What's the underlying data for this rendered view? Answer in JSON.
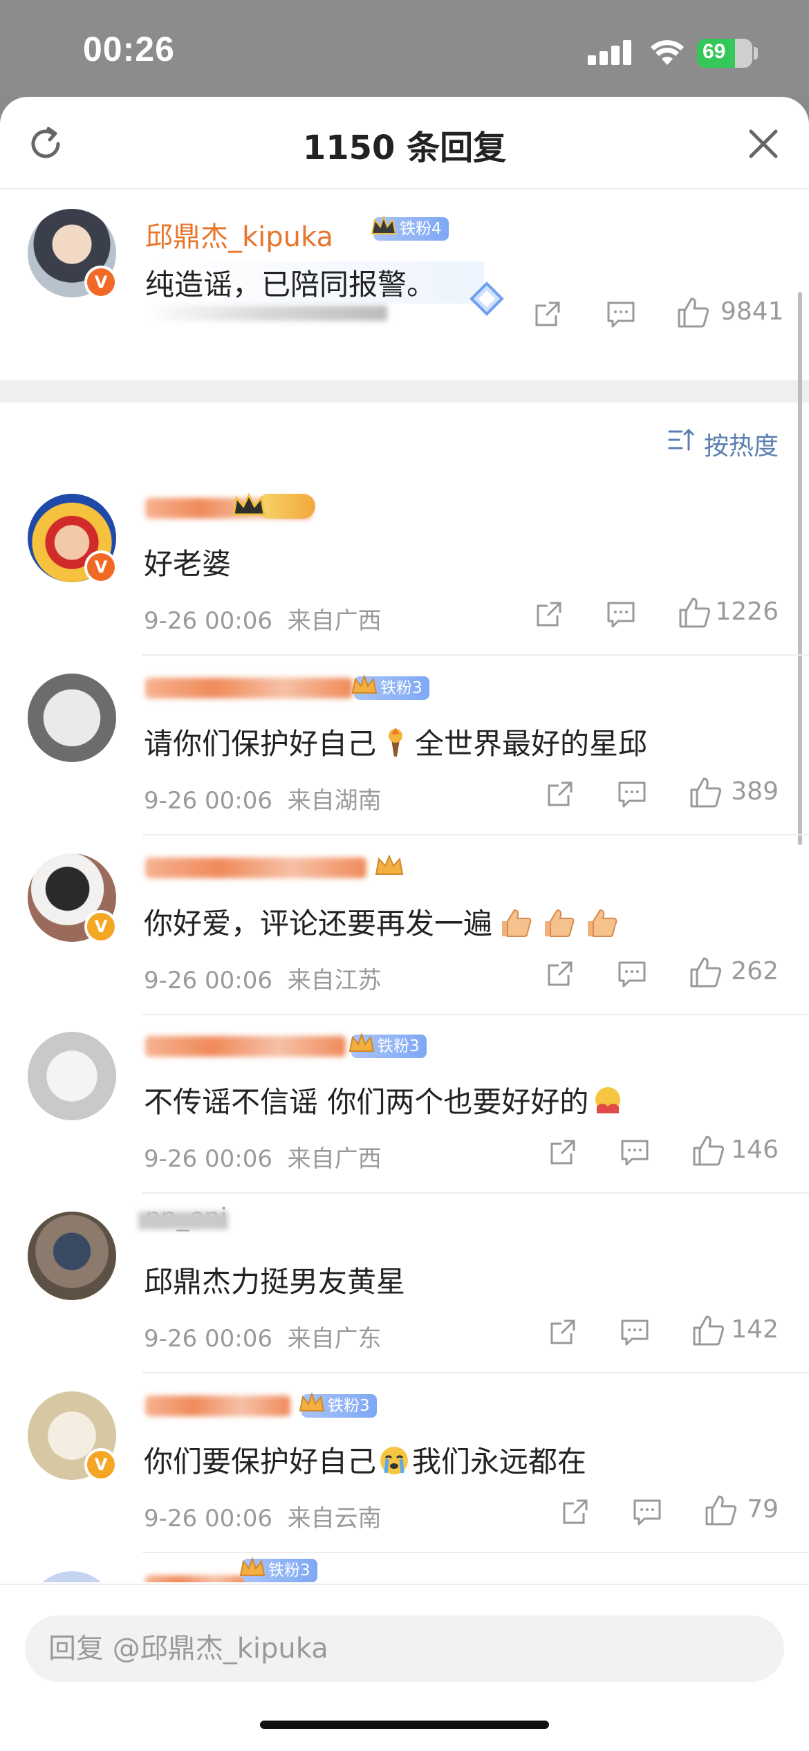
{
  "status_bar": {
    "time": "00:26",
    "battery": "69",
    "battery_level": 0.69
  },
  "header": {
    "title": "1150 条回复"
  },
  "pinned": {
    "username": "邱鼎杰_kipuka",
    "fan_badge": "铁粉4",
    "text": "纯造谣，已陪同报警。",
    "likes": "9841"
  },
  "sort": {
    "label": "按热度"
  },
  "comments": [
    {
      "username": "",
      "badge": "",
      "text": "好老婆",
      "time": "9-26 00:06",
      "location": "来自广西",
      "likes": "1226"
    },
    {
      "username": "",
      "badge": "铁粉3",
      "text": "请你们保护好自己",
      "text_after": "全世界最好的星邱",
      "time": "9-26 00:06",
      "location": "来自湖南",
      "likes": "389"
    },
    {
      "username": "",
      "badge": "",
      "text": "你好爱，评论还要再发一遍",
      "time": "9-26 00:06",
      "location": "来自江苏",
      "likes": "262"
    },
    {
      "username": "",
      "badge": "铁粉3",
      "text": "不传谣不信谣 你们两个也要好好的",
      "time": "9-26 00:06",
      "location": "来自广西",
      "likes": "146"
    },
    {
      "username": "nn_oni",
      "badge": "",
      "text": "邱鼎杰力挺男友黄星",
      "time": "9-26 00:06",
      "location": "来自广东",
      "likes": "142"
    },
    {
      "username": "",
      "badge": "铁粉3",
      "text": "你们要保护好自己",
      "text_after": "我们永远都在",
      "time": "9-26 00:06",
      "location": "来自云南",
      "likes": "79"
    },
    {
      "username": "",
      "badge": "铁粉3"
    }
  ],
  "reply": {
    "placeholder": "回复 @邱鼎杰_kipuka"
  }
}
